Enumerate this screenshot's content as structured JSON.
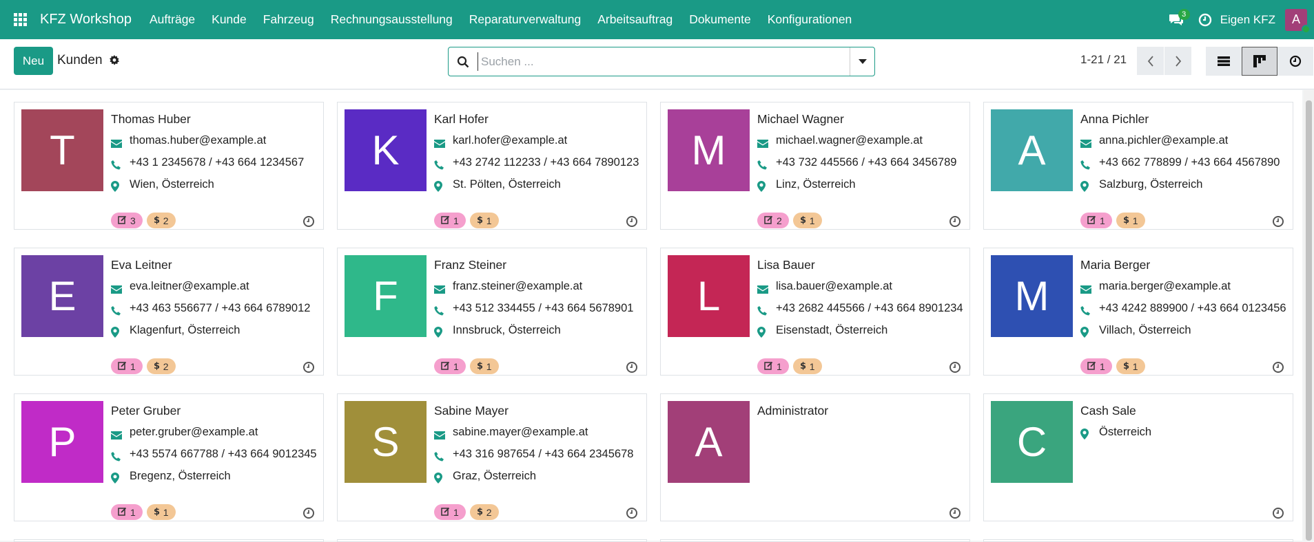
{
  "nav": {
    "app_icon": "apps-grid-icon",
    "brand": "KFZ Workshop",
    "menu": [
      "Aufträge",
      "Kunde",
      "Fahrzeug",
      "Rechnungsausstellung",
      "Reparaturverwaltung",
      "Arbeitsauftrag",
      "Dokumente",
      "Konfigurationen"
    ],
    "chat_badge": "3",
    "company": "Eigen KFZ",
    "user_initial": "A"
  },
  "control": {
    "new_label": "Neu",
    "title": "Kunden",
    "search_placeholder": "Suchen ...",
    "pager": "1-21 / 21"
  },
  "colors": {
    "brand": "#1a9a86",
    "activity_tag": "#f59fcd",
    "invoice_tag": "#f3c796"
  },
  "cards": [
    {
      "name": "Thomas Huber",
      "initial": "T",
      "color": "#a3465a",
      "email": "thomas.huber@example.at",
      "phone": "+43 1 2345678 / +43 664 1234567",
      "location": "Wien, Österreich",
      "activities": "3",
      "invoices": "2"
    },
    {
      "name": "Karl Hofer",
      "initial": "K",
      "color": "#5a2bc4",
      "email": "karl.hofer@example.at",
      "phone": "+43 2742 112233 / +43 664 7890123",
      "location": "St. Pölten, Österreich",
      "activities": "1",
      "invoices": "1"
    },
    {
      "name": "Michael Wagner",
      "initial": "M",
      "color": "#a84099",
      "email": "michael.wagner@example.at",
      "phone": "+43 732 445566 / +43 664 3456789",
      "location": "Linz, Österreich",
      "activities": "2",
      "invoices": "1"
    },
    {
      "name": "Anna Pichler",
      "initial": "A",
      "color": "#41a9aa",
      "email": "anna.pichler@example.at",
      "phone": "+43 662 778899 / +43 664 4567890",
      "location": "Salzburg, Österreich",
      "activities": "1",
      "invoices": "1"
    },
    {
      "name": "Eva Leitner",
      "initial": "E",
      "color": "#6c41a4",
      "email": "eva.leitner@example.at",
      "phone": "+43 463 556677 / +43 664 6789012",
      "location": "Klagenfurt, Österreich",
      "activities": "1",
      "invoices": "2"
    },
    {
      "name": "Franz Steiner",
      "initial": "F",
      "color": "#2fb88a",
      "email": "franz.steiner@example.at",
      "phone": "+43 512 334455 / +43 664 5678901",
      "location": "Innsbruck, Österreich",
      "activities": "1",
      "invoices": "1"
    },
    {
      "name": "Lisa Bauer",
      "initial": "L",
      "color": "#c42655",
      "email": "lisa.bauer@example.at",
      "phone": "+43 2682 445566 / +43 664 8901234",
      "location": "Eisenstadt, Österreich",
      "activities": "1",
      "invoices": "1"
    },
    {
      "name": "Maria Berger",
      "initial": "M",
      "color": "#2e50b2",
      "email": "maria.berger@example.at",
      "phone": "+43 4242 889900 / +43 664 0123456",
      "location": "Villach, Österreich",
      "activities": "1",
      "invoices": "1"
    },
    {
      "name": "Peter Gruber",
      "initial": "P",
      "color": "#c02bc7",
      "email": "peter.gruber@example.at",
      "phone": "+43 5574 667788 / +43 664 9012345",
      "location": "Bregenz, Österreich",
      "activities": "1",
      "invoices": "1"
    },
    {
      "name": "Sabine Mayer",
      "initial": "S",
      "color": "#a08f3a",
      "email": "sabine.mayer@example.at",
      "phone": "+43 316 987654 / +43 664 2345678",
      "location": "Graz, Österreich",
      "activities": "1",
      "invoices": "2"
    },
    {
      "name": "Administrator",
      "initial": "A",
      "color": "#a23f78"
    },
    {
      "name": "Cash Sale",
      "initial": "C",
      "color": "#3aa57e",
      "location": "Österreich"
    }
  ]
}
